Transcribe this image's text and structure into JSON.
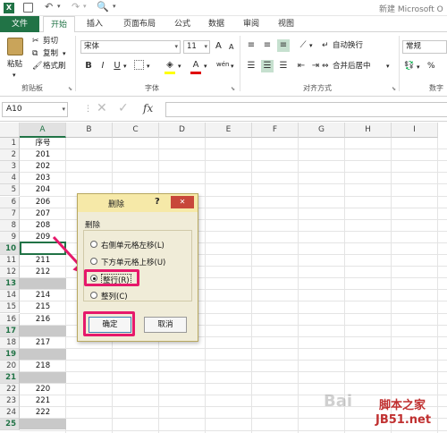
{
  "title_bar": {
    "title": "新建 Microsoft O"
  },
  "tabs": [
    {
      "label": "文件"
    },
    {
      "label": "开始"
    },
    {
      "label": "插入"
    },
    {
      "label": "页面布局"
    },
    {
      "label": "公式"
    },
    {
      "label": "数据"
    },
    {
      "label": "审阅"
    },
    {
      "label": "视图"
    }
  ],
  "ribbon": {
    "clipboard": {
      "paste": "粘贴",
      "cut": "剪切",
      "copy": "复制",
      "format_painter": "格式刷",
      "group": "剪贴板"
    },
    "font": {
      "name": "宋体",
      "size": "11",
      "bold": "B",
      "italic": "I",
      "underline": "U",
      "grow": "A",
      "shrink": "A",
      "wen": "wén",
      "color_a": "A",
      "group": "字体"
    },
    "alignment": {
      "wrap": "自动换行",
      "merge": "合并后居中",
      "group": "对齐方式"
    },
    "number": {
      "format": "常规",
      "group": "数字"
    }
  },
  "formula_bar": {
    "name_box": "A10",
    "fx": "fx"
  },
  "columns": [
    "A",
    "B",
    "C",
    "D",
    "E",
    "F",
    "G",
    "H",
    "I"
  ],
  "rows": [
    {
      "num": "1",
      "value": "序号"
    },
    {
      "num": "2",
      "value": "201"
    },
    {
      "num": "3",
      "value": "202"
    },
    {
      "num": "4",
      "value": "203"
    },
    {
      "num": "5",
      "value": "204"
    },
    {
      "num": "6",
      "value": "206"
    },
    {
      "num": "7",
      "value": "207"
    },
    {
      "num": "8",
      "value": "208"
    },
    {
      "num": "9",
      "value": "209"
    },
    {
      "num": "10",
      "value": ""
    },
    {
      "num": "11",
      "value": "211"
    },
    {
      "num": "12",
      "value": "212"
    },
    {
      "num": "13",
      "value": ""
    },
    {
      "num": "14",
      "value": "214"
    },
    {
      "num": "15",
      "value": "215"
    },
    {
      "num": "16",
      "value": "216"
    },
    {
      "num": "17",
      "value": ""
    },
    {
      "num": "18",
      "value": "217"
    },
    {
      "num": "19",
      "value": ""
    },
    {
      "num": "20",
      "value": "218"
    },
    {
      "num": "21",
      "value": ""
    },
    {
      "num": "22",
      "value": "220"
    },
    {
      "num": "23",
      "value": "221"
    },
    {
      "num": "24",
      "value": "222"
    },
    {
      "num": "25",
      "value": ""
    }
  ],
  "dialog": {
    "title": "删除",
    "help": "?",
    "close": "✕",
    "group_label": "删除",
    "options": [
      {
        "label": "右侧单元格左移(L)",
        "selected": false
      },
      {
        "label": "下方单元格上移(U)",
        "selected": false
      },
      {
        "label": "整行(R)",
        "selected": true
      },
      {
        "label": "整列(C)",
        "selected": false
      }
    ],
    "ok": "确定",
    "cancel": "取消"
  },
  "watermark": {
    "line1": "脚本之家",
    "line2": "JB51.net",
    "baidu": "Bai"
  },
  "colors": {
    "excel_green": "#217346",
    "highlight": "#e6196b",
    "dialog_bg": "#f0ecd8",
    "dialog_title": "#f6e9a8"
  }
}
